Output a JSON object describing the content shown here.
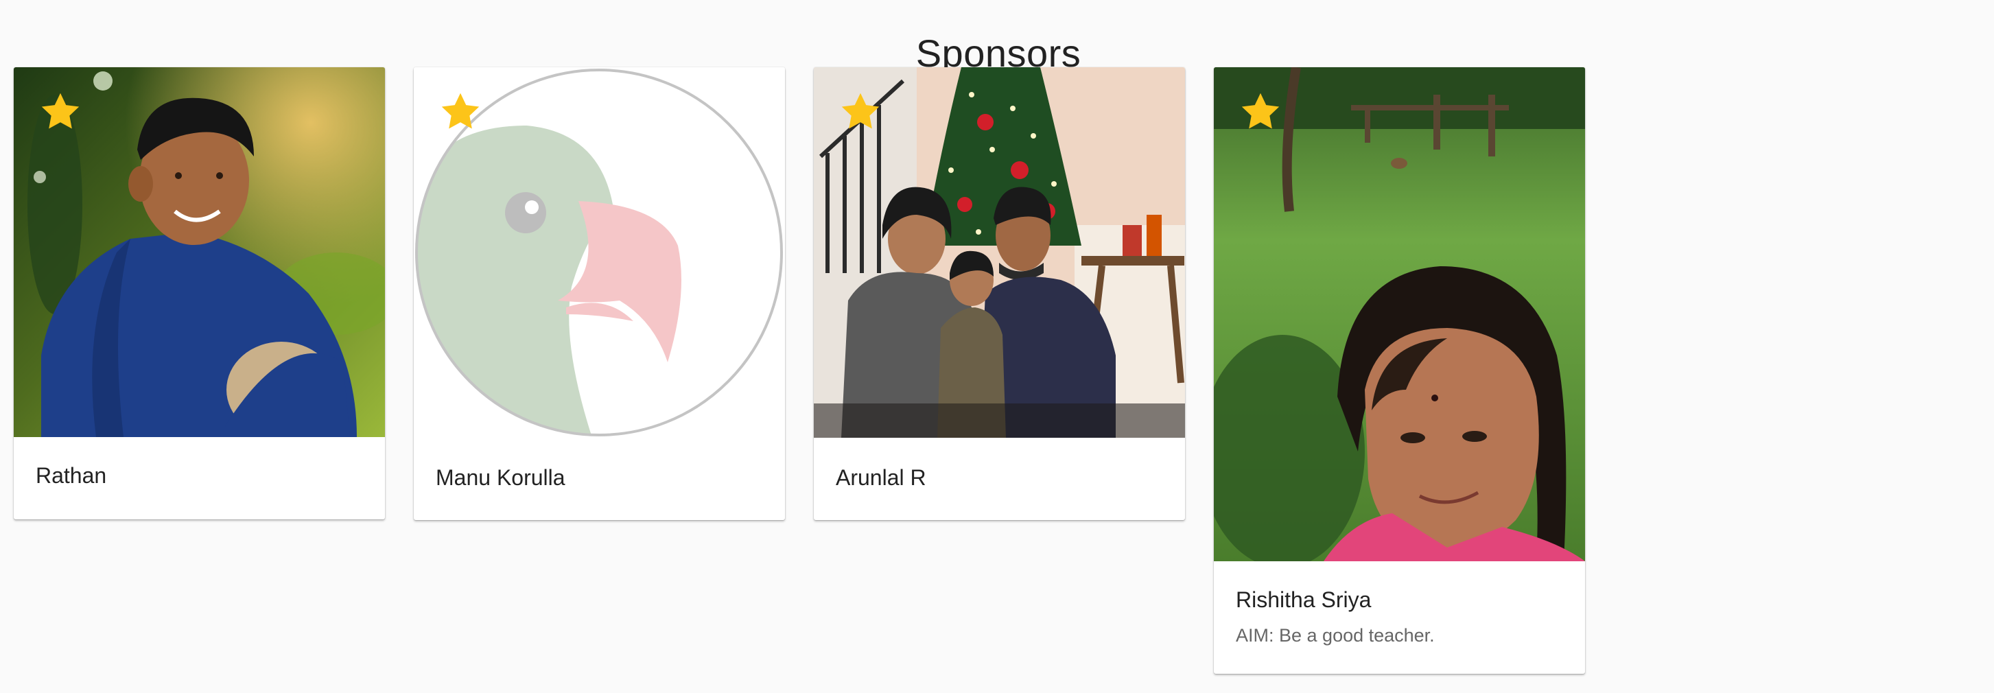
{
  "page": {
    "title": "Sponsors"
  },
  "colors": {
    "background": "#fafafa",
    "star": "#fcc419",
    "card": "#ffffff"
  },
  "sponsors": [
    {
      "name": "Rathan",
      "aim": "",
      "photo_icon": "boy-portrait-photo",
      "featured": true
    },
    {
      "name": "Manu Korulla",
      "aim": "",
      "photo_icon": "parrot-avatar-placeholder",
      "featured": true
    },
    {
      "name": "Arunlal R",
      "aim": "",
      "photo_icon": "family-christmas-photo",
      "featured": true
    },
    {
      "name": "Rishitha Sriya",
      "aim": "AIM: Be a good teacher.",
      "photo_icon": "girl-selfie-photo",
      "featured": true
    }
  ]
}
